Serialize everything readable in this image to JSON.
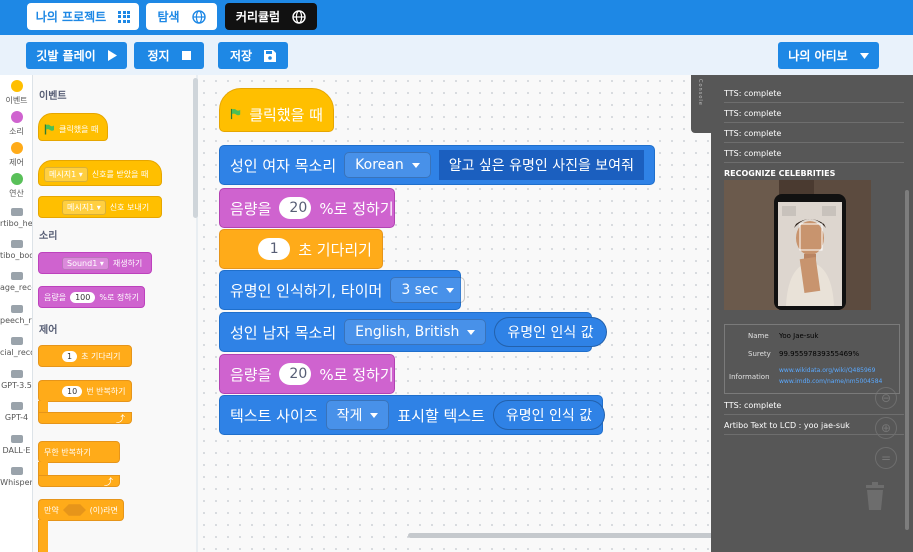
{
  "topnav": {
    "my_projects": "나의 프로젝트",
    "explore": "탐색",
    "curriculum": "커리큘럼"
  },
  "actions": {
    "flag_play": "깃발 플레이",
    "stop": "정지",
    "save": "저장",
    "my_artibo": "나의 아티보"
  },
  "categories": [
    {
      "label": "이벤트",
      "color": "#ffbf00"
    },
    {
      "label": "소리",
      "color": "#cf63cf"
    },
    {
      "label": "제어",
      "color": "#ffab19"
    },
    {
      "label": "연산",
      "color": "#59c059"
    },
    {
      "label": "rtibo_head"
    },
    {
      "label": "tibo_body"
    },
    {
      "label": "age_recog"
    },
    {
      "label": "peech_reco"
    },
    {
      "label": "cial_recog"
    },
    {
      "label": "GPT-3.5"
    },
    {
      "label": "GPT-4"
    },
    {
      "label": "DALL·E"
    },
    {
      "label": "Whisper"
    }
  ],
  "palette": {
    "events_title": "이벤트",
    "when_flag": "클릭했을 때",
    "msg1": "메시지1",
    "received": "신호를 받았을 때",
    "msg2": "메시지1",
    "send": "신호 보내기",
    "sound_title": "소리",
    "sound1": "Sound1",
    "play": "재생하기",
    "vol_pre": "음량을",
    "vol_val": "100",
    "vol_post": "%로 정하기",
    "control_title": "제어",
    "wait_val": "1",
    "wait_post": "초 기다리기",
    "repeat_val": "10",
    "repeat_post": "번 반복하기",
    "forever": "무한 반복하기",
    "if_pre": "만약",
    "if_post": "(이)라면"
  },
  "script": {
    "hat": "클릭했을 때",
    "b1_label": "성인 여자 목소리",
    "b1_lang": "Korean",
    "b1_text": "알고 싶은 유명인 사진을 보여줘",
    "b2_pre": "음량을",
    "b2_val": "20",
    "b2_post": "%로 정하기",
    "b3_val": "1",
    "b3_post": "초 기다리기",
    "b4_label": "유명인 인식하기, 타이머",
    "b4_timer": "3 sec",
    "b5_label": "성인 남자 목소리",
    "b5_lang": "English, British",
    "b5_rep": "유명인 인식 값",
    "b6_pre": "음량을",
    "b6_val": "20",
    "b6_post": "%로 정하기",
    "b7_label": "텍스트 사이즈",
    "b7_size": "작게",
    "b7_mid": "표시할 텍스트",
    "b7_rep": "유명인 인식 값"
  },
  "output": {
    "console_tab": "Console",
    "lines_top": [
      "TTS: complete",
      "TTS: complete",
      "TTS: complete",
      "TTS: complete"
    ],
    "recognize_title": "RECOGNIZE CELEBRITIES",
    "name_label": "Name",
    "name_value": "Yoo Jae-suk",
    "surety_label": "Surety",
    "surety_value": "99.95597839355469%",
    "info_label": "Information",
    "info_link1": "www.wikidata.org/wiki/Q485969",
    "info_link2": "www.imdb.com/name/nm5004584",
    "line_tts": "TTS: complete",
    "line_lcd": "Artibo Text to LCD : yoo jae-suk"
  }
}
